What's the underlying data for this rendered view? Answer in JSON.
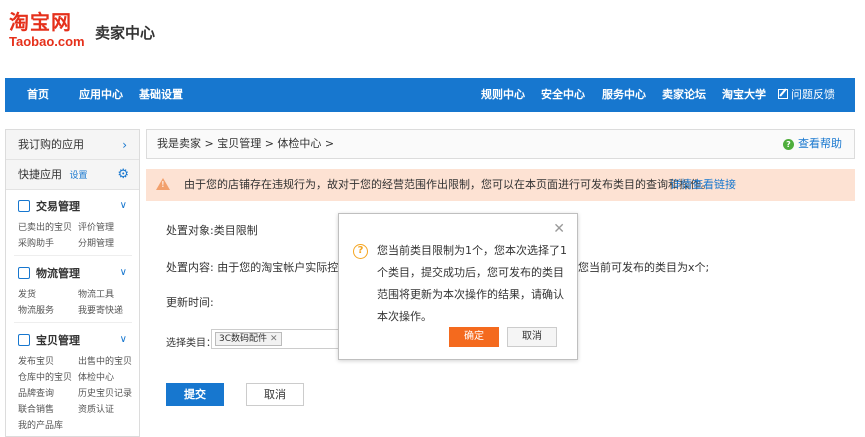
{
  "header": {
    "logo_cn": "淘宝网",
    "logo_en": "Taobao.com",
    "title": "卖家中心"
  },
  "nav": {
    "left": [
      "首页",
      "应用中心",
      "基础设置"
    ],
    "right": [
      "规则中心",
      "安全中心",
      "服务中心",
      "卖家论坛",
      "淘宝大学"
    ],
    "feedback": "问题反馈"
  },
  "sidebar": {
    "my_apps": "我订购的应用",
    "quick_apps": "快捷应用",
    "quick_settings": "设置",
    "groups": [
      {
        "title": "交易管理",
        "links": [
          "已卖出的宝贝",
          "评价管理",
          "采购助手",
          "分期管理"
        ]
      },
      {
        "title": "物流管理",
        "links": [
          "发货",
          "物流工具",
          "物流服务",
          "我要寄快递"
        ]
      },
      {
        "title": "宝贝管理",
        "links": [
          "发布宝贝",
          "出售中的宝贝",
          "仓库中的宝贝",
          "体检中心",
          "品牌查询",
          "历史宝贝记录",
          "联合销售",
          "资质认证",
          "我的产品库"
        ]
      }
    ]
  },
  "breadcrumb": "我是卖家 > 宝贝管理 > 体检中心 >",
  "help": "查看帮助",
  "warning": {
    "text": "由于您的店铺存在违规行为，故对于您的经营范围作出限制，您可以在本页面进行可发布类目的查询和操作。",
    "link": "详情查看链接"
  },
  "form": {
    "object": "处置对象:类目限制",
    "content": "处置内容: 由于您的淘宝帐户实际控制人",
    "content_tail": "您当前可发布的类目为x个;",
    "update_time": "更新时间:",
    "select_label": "选择类目：",
    "selected_tag": "3C数码配件",
    "submit": "提交",
    "cancel": "取消"
  },
  "dialog": {
    "message": "您当前类目限制为1个，您本次选择了1个类目，提交成功后，您可发布的类目范围将更新为本次操作的结果，请确认本次操作。",
    "ok": "确定",
    "cancel": "取消"
  },
  "colors": {
    "nav_blue": "#1777cf",
    "brand_red": "#e5301b",
    "warning_bg": "#fde2d3",
    "confirm_orange": "#f46a1e"
  }
}
